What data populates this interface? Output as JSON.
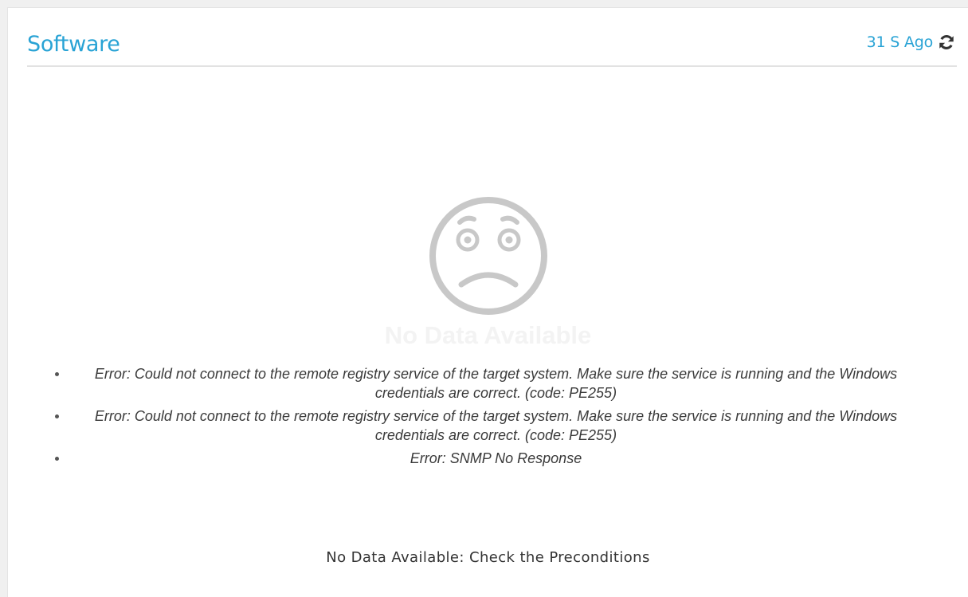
{
  "panel": {
    "title": "Software",
    "refresh_text": "31 S Ago",
    "refresh_icon": "refresh-icon"
  },
  "empty_state": {
    "icon": "sad-face-icon",
    "watermark": "No Data Available"
  },
  "errors": [
    "Error: Could not connect to the remote registry service of the target system. Make sure the service is running and the Windows credentials are correct. (code: PE255)",
    "Error: Could not connect to the remote registry service of the target system. Make sure the service is running and the Windows credentials are correct. (code: PE255)",
    "Error: SNMP No Response"
  ],
  "footer_note": "No Data Available: Check the Preconditions",
  "colors": {
    "accent": "#29a3d5",
    "icon_gray": "#c8c8c8",
    "text": "#3a3a3a"
  }
}
